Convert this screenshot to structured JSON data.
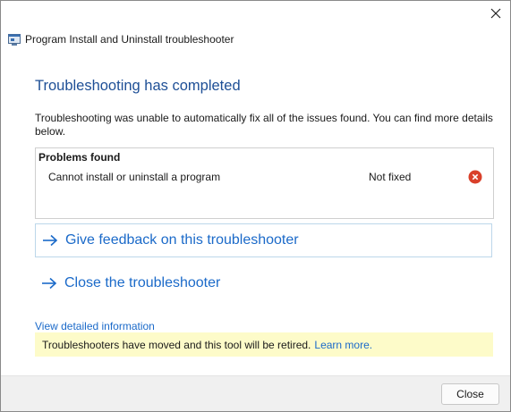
{
  "window": {
    "title": "Program Install and Uninstall troubleshooter",
    "close_icon": "close-icon"
  },
  "main": {
    "heading": "Troubleshooting has completed",
    "description": "Troubleshooting was unable to automatically fix all of the issues found. You can find more details below."
  },
  "problems": {
    "header": "Problems found",
    "items": [
      {
        "name": "Cannot install or uninstall a program",
        "status": "Not fixed",
        "status_icon": "error-x-icon"
      }
    ]
  },
  "options": [
    {
      "label": "Give feedback on this troubleshooter",
      "icon": "arrow-right-icon"
    },
    {
      "label": "Close the troubleshooter",
      "icon": "arrow-right-icon"
    }
  ],
  "details_link": "View detailed information",
  "banner": {
    "text": "Troubleshooters have moved and this tool will be retired.",
    "link": "Learn more."
  },
  "footer": {
    "close_label": "Close"
  },
  "colors": {
    "heading": "#1e4f96",
    "link": "#1b6ac9",
    "error": "#d9402a",
    "banner_bg": "#fdfbc9"
  }
}
